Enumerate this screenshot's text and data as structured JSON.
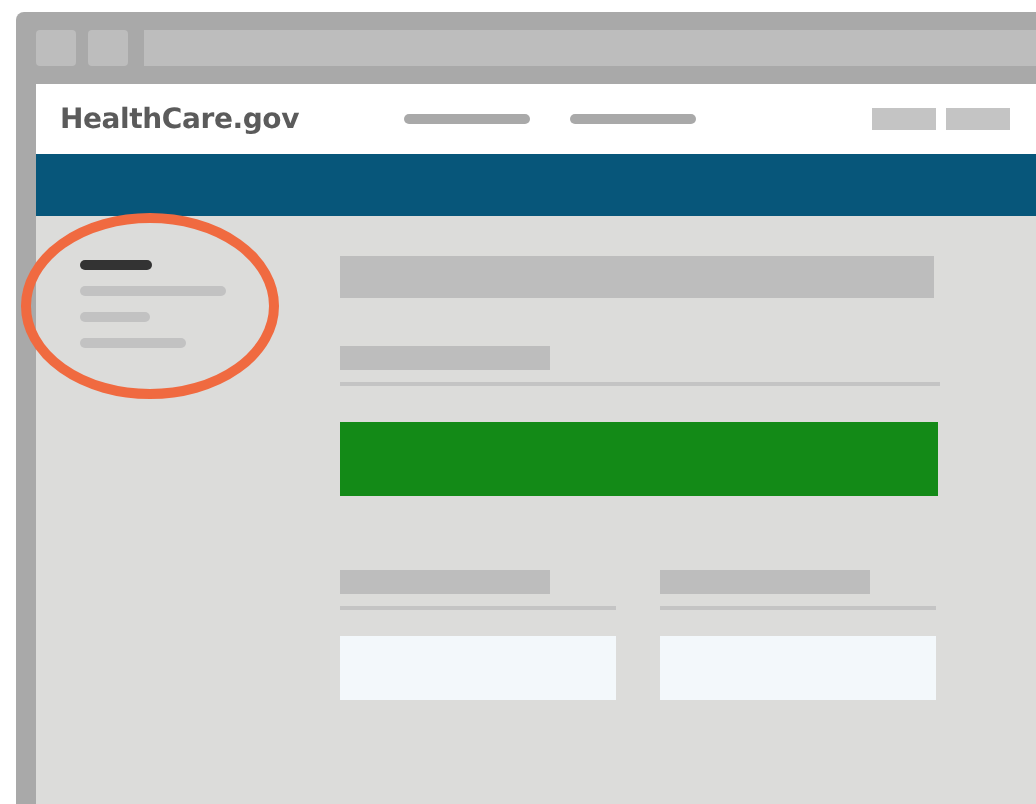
{
  "header": {
    "logo": "HealthCare.gov"
  }
}
